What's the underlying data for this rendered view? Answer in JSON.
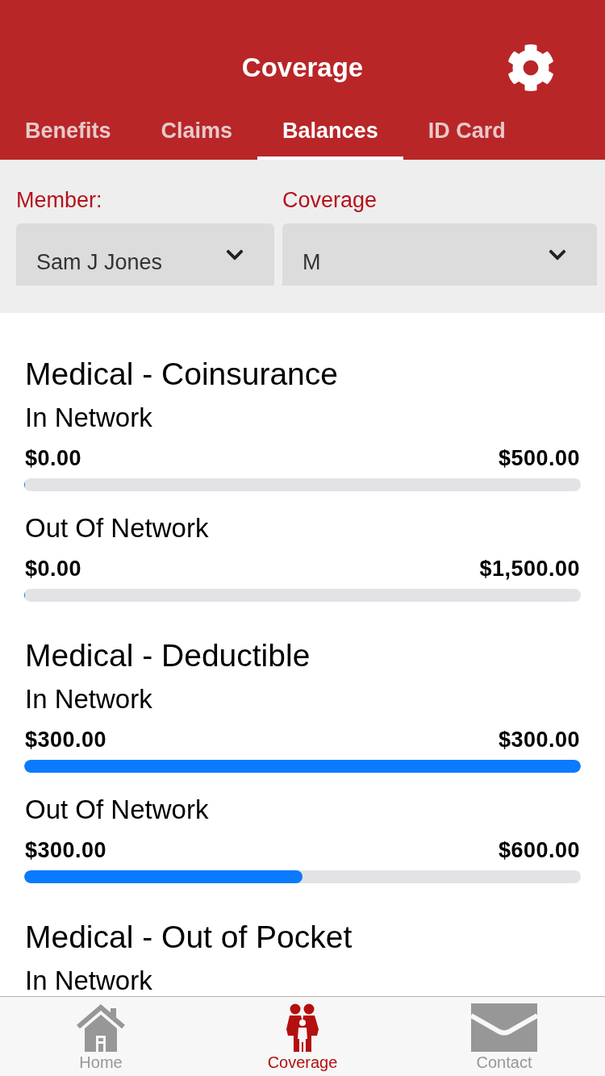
{
  "header": {
    "title": "Coverage"
  },
  "tabs": [
    {
      "label": "Benefits",
      "selected": false
    },
    {
      "label": "Claims",
      "selected": false
    },
    {
      "label": "Balances",
      "selected": true
    },
    {
      "label": "ID Card",
      "selected": false
    }
  ],
  "filters": [
    {
      "label": "Member:",
      "value": "Sam J Jones"
    },
    {
      "label": "Coverage",
      "value": "M"
    }
  ],
  "sections": [
    {
      "title": "Medical - Coinsurance",
      "networks": [
        {
          "label": "In Network",
          "used": "$0.00",
          "limit": "$500.00",
          "level": 0
        },
        {
          "label": "Out Of Network",
          "used": "$0.00",
          "limit": "$1,500.00",
          "level": 0
        }
      ]
    },
    {
      "title": "Medical - Deductible",
      "networks": [
        {
          "label": "In Network",
          "used": "$300.00",
          "limit": "$300.00",
          "level": 1
        },
        {
          "label": "Out Of Network",
          "used": "$300.00",
          "limit": "$600.00",
          "level": 0.5
        }
      ]
    },
    {
      "title": "Medical - Out of Pocket",
      "networks": [
        {
          "label": "In Network"
        }
      ]
    }
  ],
  "bottom_nav": [
    {
      "label": "Home",
      "kind": "home",
      "selected": false
    },
    {
      "label": "Coverage",
      "kind": "family",
      "selected": true
    },
    {
      "label": "Contact",
      "kind": "mail",
      "selected": false
    }
  ]
}
